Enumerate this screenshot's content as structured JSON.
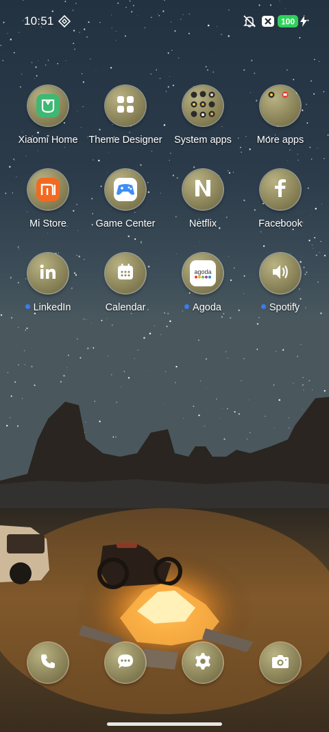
{
  "status_bar": {
    "time": "10:51",
    "battery": "100",
    "icons": [
      "diamond-grid-icon",
      "mute-bell-icon",
      "x-box-icon",
      "battery-icon",
      "charging-bolt-icon"
    ]
  },
  "apps": [
    {
      "label": "Xiaomi Home",
      "icon": "xiaomi-home-icon",
      "dot": false
    },
    {
      "label": "Theme Designer",
      "icon": "theme-designer-icon",
      "dot": false
    },
    {
      "label": "System apps",
      "icon": "folder-icon",
      "dot": false
    },
    {
      "label": "More apps",
      "icon": "folder-icon",
      "dot": false
    },
    {
      "label": "Mi Store",
      "icon": "mi-store-icon",
      "dot": false
    },
    {
      "label": "Game Center",
      "icon": "game-center-icon",
      "dot": false
    },
    {
      "label": "Netflix",
      "icon": "netflix-icon",
      "dot": false
    },
    {
      "label": "Facebook",
      "icon": "facebook-icon",
      "dot": false
    },
    {
      "label": "LinkedIn",
      "icon": "linkedin-icon",
      "dot": true
    },
    {
      "label": "Calendar",
      "icon": "calendar-icon",
      "dot": false
    },
    {
      "label": "Agoda",
      "icon": "agoda-icon",
      "dot": true,
      "logo_text": "agoda"
    },
    {
      "label": "Spotify",
      "icon": "speaker-icon",
      "dot": true
    }
  ],
  "dock": [
    {
      "name": "phone",
      "icon": "phone-icon"
    },
    {
      "name": "messages",
      "icon": "chat-bubble-icon"
    },
    {
      "name": "settings",
      "icon": "gear-icon"
    },
    {
      "name": "camera",
      "icon": "camera-icon"
    }
  ],
  "colors": {
    "notification_dot": "#3a7cf0",
    "battery_green": "#2fd05a",
    "icon_ring": "#a9a276"
  }
}
